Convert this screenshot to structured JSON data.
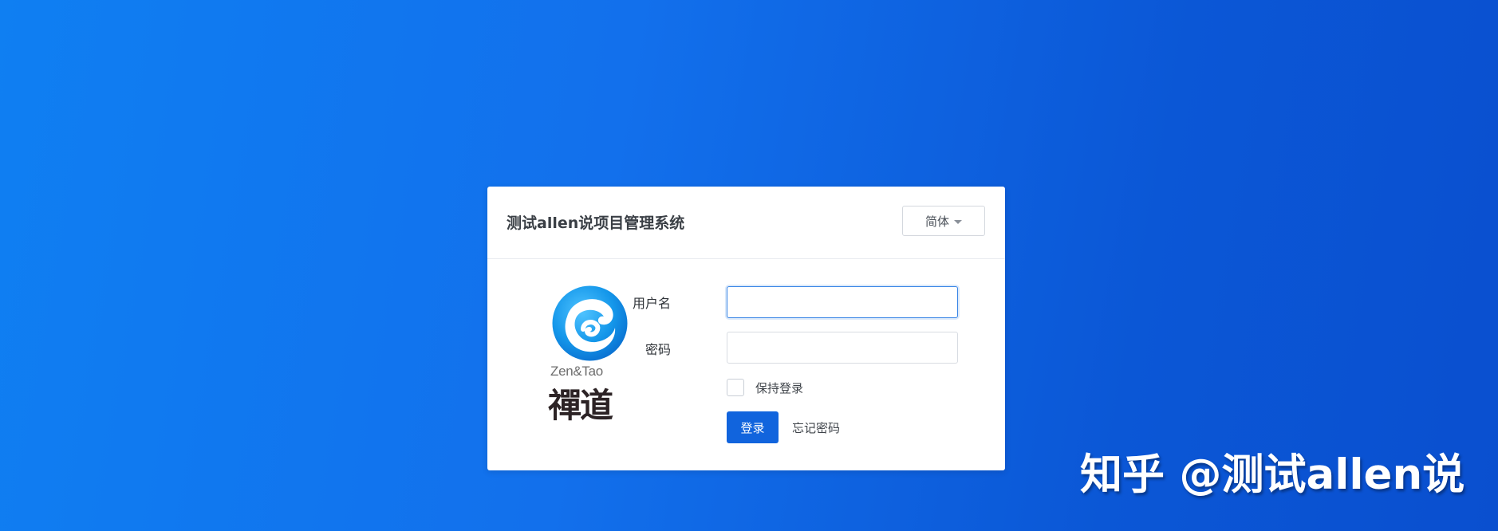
{
  "login": {
    "title": "测试allen说项目管理系统",
    "language": {
      "selected": "简体"
    },
    "logo": {
      "text_en": "Zen&Tao",
      "text_cn": "禪道"
    },
    "form": {
      "username_label": "用户名",
      "username_value": "",
      "password_label": "密码",
      "password_value": "",
      "remember_label": "保持登录",
      "remember_checked": false,
      "submit_label": "登录",
      "forgot_label": "忘记密码"
    }
  },
  "watermark": {
    "text": "知乎 @测试allen说"
  },
  "colors": {
    "background_start": "#0f7ff2",
    "background_end": "#0a4fcf",
    "primary_button": "#1164dd",
    "input_focus": "#3a86e6"
  }
}
